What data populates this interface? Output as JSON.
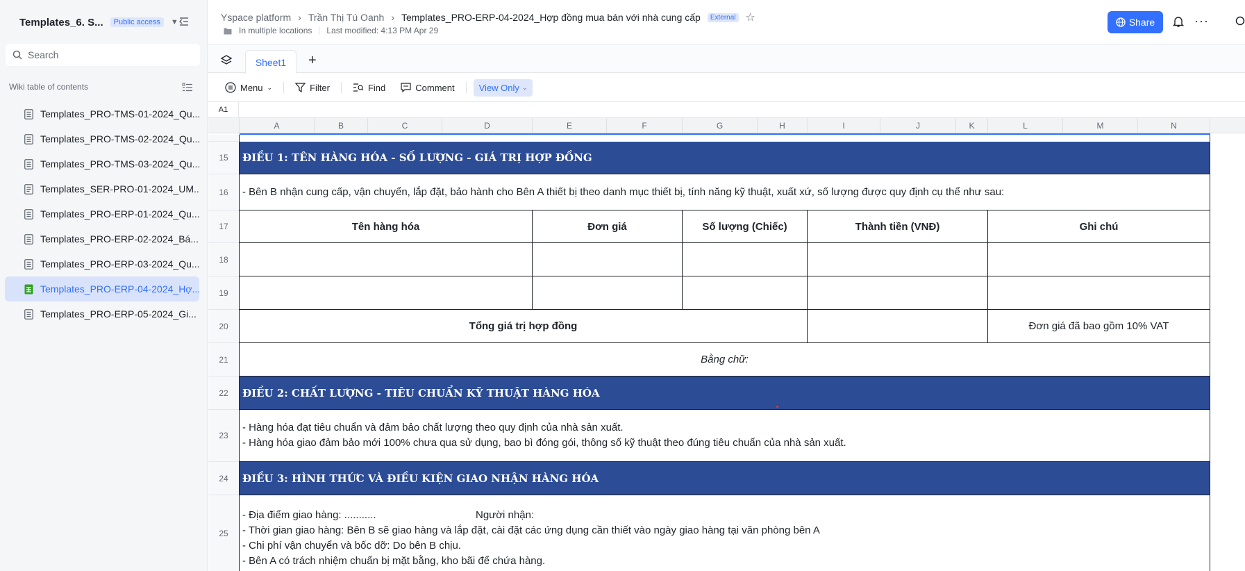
{
  "sidebar": {
    "title": "Templates_6. S...",
    "access_badge": "Public access",
    "search_placeholder": "Search",
    "toc_label": "Wiki table of contents",
    "items": [
      {
        "label": "Templates_PRO-TMS-01-2024_Qu..."
      },
      {
        "label": "Templates_PRO-TMS-02-2024_Qu..."
      },
      {
        "label": "Templates_PRO-TMS-03-2024_Qu..."
      },
      {
        "label": "Templates_SER-PRO-01-2024_UM..."
      },
      {
        "label": "Templates_PRO-ERP-01-2024_Qu..."
      },
      {
        "label": "Templates_PRO-ERP-02-2024_Bá..."
      },
      {
        "label": "Templates_PRO-ERP-03-2024_Qu..."
      },
      {
        "label": "Templates_PRO-ERP-04-2024_Hợ..."
      },
      {
        "label": "Templates_PRO-ERP-05-2024_Gi..."
      }
    ]
  },
  "header": {
    "breadcrumb": [
      "Yspace platform",
      "Trần Thị Tú Oanh",
      "Templates_PRO-ERP-04-2024_Hợp đồng mua bán với nhà cung cấp"
    ],
    "external_badge": "External",
    "location": "In multiple locations",
    "modified": "Last modified: 4:13 PM Apr 29",
    "share_label": "Share"
  },
  "tabs": {
    "sheet": "Sheet1"
  },
  "toolbar": {
    "menu": "Menu",
    "filter": "Filter",
    "find": "Find",
    "comment": "Comment",
    "view_only": "View Only"
  },
  "formula": {
    "cell_ref": "A1"
  },
  "columns": [
    "A",
    "B",
    "C",
    "D",
    "E",
    "F",
    "G",
    "H",
    "I",
    "J",
    "K",
    "L",
    "M",
    "N"
  ],
  "rows": {
    "r15": {
      "num": "15",
      "text": "ĐIỀU 1: TÊN HÀNG HÓA - SỐ LƯỢNG - GIÁ TRỊ HỢP ĐỒNG"
    },
    "r16": {
      "num": "16",
      "text": "- Bên B nhận cung cấp, vận chuyển, lắp đặt, bảo hành cho Bên A thiết bị theo danh mục thiết bị, tính năng kỹ thuật, xuất xứ, số lượng được quy định cụ thể như sau:"
    },
    "r17": {
      "num": "17",
      "h1": "Tên hàng hóa",
      "h2": "Đơn giá",
      "h3": "Số lượng (Chiếc)",
      "h4": "Thành tiền (VNĐ)",
      "h5": "Ghi chú"
    },
    "r18": {
      "num": "18"
    },
    "r19": {
      "num": "19"
    },
    "r20": {
      "num": "20",
      "total": "Tổng giá trị hợp đồng",
      "note": "Đơn giá đã bao gồm 10% VAT"
    },
    "r21": {
      "num": "21",
      "words": "Bằng chữ:"
    },
    "r22": {
      "num": "22",
      "text": "ĐIỀU 2: CHẤT LƯỢNG - TIÊU CHUẨN KỸ THUẬT HÀNG HÓA"
    },
    "r23": {
      "num": "23",
      "line1": "- Hàng hóa đạt tiêu chuẩn và đảm bảo chất lượng theo quy định của nhà sản xuất.",
      "line2": "- Hàng hóa giao đảm bảo mới 100% chưa qua sử dụng, bao bì đóng gói, thông số kỹ thuật theo đúng tiêu chuẩn của nhà sản xuất."
    },
    "r24": {
      "num": "24",
      "text": "ĐIỀU 3: HÌNH THỨC VÀ ĐIỀU KIỆN GIAO NHẬN HÀNG HÓA"
    },
    "r25": {
      "num": "25",
      "line1a": "- Địa điểm giao hàng: ...........",
      "line1b": "Người nhận:",
      "line2": "- Thời gian giao hàng: Bên B sẽ giao hàng và lắp đặt, cài đặt các ứng dụng cần thiết vào ngày giao hàng tại văn phòng bên A",
      "line3": "- Chi phí vận chuyển và bốc dỡ: Do bên B chịu.",
      "line4": "- Bên A có trách nhiệm chuẩn bị mặt bằng, kho bãi để chứa hàng."
    }
  }
}
